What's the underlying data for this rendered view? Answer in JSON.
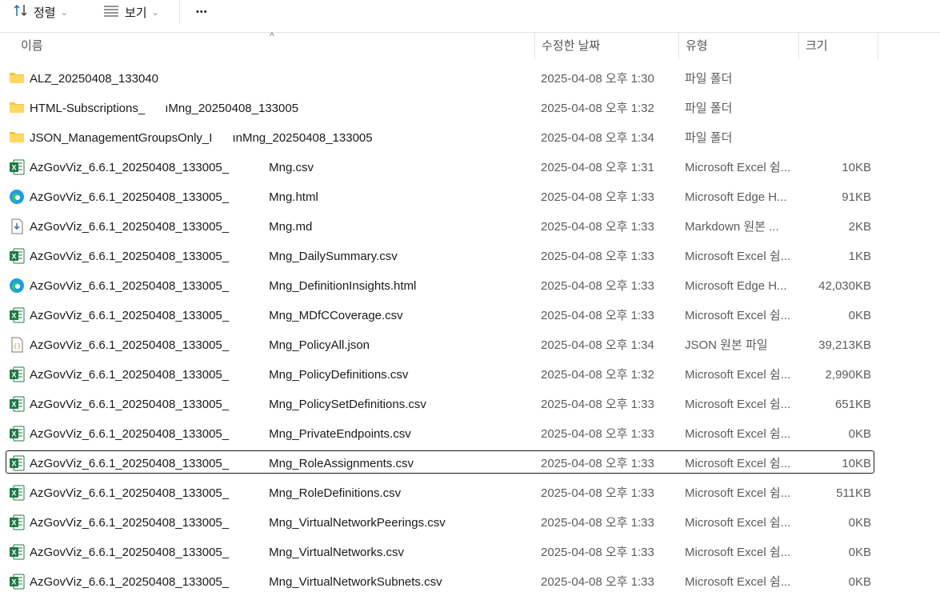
{
  "toolbar": {
    "sort_label": "정렬",
    "view_label": "보기",
    "more_label": "•••"
  },
  "columns": {
    "name": "이름",
    "date": "수정한 날짜",
    "type": "유형",
    "size": "크기"
  },
  "files": [
    {
      "icon": "folder-icon",
      "name": "ALZ_20250408_133040",
      "date": "2025-04-08 오후 1:30",
      "type": "파일 폴더",
      "size": ""
    },
    {
      "icon": "folder-icon",
      "name": "HTML-Subscriptions_      ıMng_20250408_133005",
      "date": "2025-04-08 오후 1:32",
      "type": "파일 폴더",
      "size": ""
    },
    {
      "icon": "folder-icon",
      "name": "JSON_ManagementGroupsOnly_I      ınMng_20250408_133005",
      "date": "2025-04-08 오후 1:34",
      "type": "파일 폴더",
      "size": ""
    },
    {
      "icon": "excel-icon",
      "name": "AzGovViz_6.6.1_20250408_133005_            Mng.csv",
      "date": "2025-04-08 오후 1:31",
      "type": "Microsoft Excel 쉼...",
      "size": "10KB"
    },
    {
      "icon": "edge-icon",
      "name": "AzGovViz_6.6.1_20250408_133005_            Mng.html",
      "date": "2025-04-08 오후 1:33",
      "type": "Microsoft Edge H...",
      "size": "91KB"
    },
    {
      "icon": "markdown-icon",
      "name": "AzGovViz_6.6.1_20250408_133005_            Mng.md",
      "date": "2025-04-08 오후 1:33",
      "type": "Markdown 원본 ...",
      "size": "2KB"
    },
    {
      "icon": "excel-icon",
      "name": "AzGovViz_6.6.1_20250408_133005_            Mng_DailySummary.csv",
      "date": "2025-04-08 오후 1:33",
      "type": "Microsoft Excel 쉼...",
      "size": "1KB"
    },
    {
      "icon": "edge-icon",
      "name": "AzGovViz_6.6.1_20250408_133005_            Mng_DefinitionInsights.html",
      "date": "2025-04-08 오후 1:33",
      "type": "Microsoft Edge H...",
      "size": "42,030KB"
    },
    {
      "icon": "excel-icon",
      "name": "AzGovViz_6.6.1_20250408_133005_            Mng_MDfCCoverage.csv",
      "date": "2025-04-08 오후 1:33",
      "type": "Microsoft Excel 쉼...",
      "size": "0KB"
    },
    {
      "icon": "json-icon",
      "name": "AzGovViz_6.6.1_20250408_133005_            Mng_PolicyAll.json",
      "date": "2025-04-08 오후 1:34",
      "type": "JSON 원본 파일",
      "size": "39,213KB"
    },
    {
      "icon": "excel-icon",
      "name": "AzGovViz_6.6.1_20250408_133005_            Mng_PolicyDefinitions.csv",
      "date": "2025-04-08 오후 1:32",
      "type": "Microsoft Excel 쉼...",
      "size": "2,990KB"
    },
    {
      "icon": "excel-icon",
      "name": "AzGovViz_6.6.1_20250408_133005_            Mng_PolicySetDefinitions.csv",
      "date": "2025-04-08 오후 1:33",
      "type": "Microsoft Excel 쉼...",
      "size": "651KB"
    },
    {
      "icon": "excel-icon",
      "name": "AzGovViz_6.6.1_20250408_133005_            Mng_PrivateEndpoints.csv",
      "date": "2025-04-08 오후 1:33",
      "type": "Microsoft Excel 쉼...",
      "size": "0KB"
    },
    {
      "icon": "excel-icon",
      "name": "AzGovViz_6.6.1_20250408_133005_            Mng_RoleAssignments.csv",
      "date": "2025-04-08 오후 1:33",
      "type": "Microsoft Excel 쉼...",
      "size": "10KB",
      "selected": true
    },
    {
      "icon": "excel-icon",
      "name": "AzGovViz_6.6.1_20250408_133005_            Mng_RoleDefinitions.csv",
      "date": "2025-04-08 오후 1:33",
      "type": "Microsoft Excel 쉼...",
      "size": "511KB"
    },
    {
      "icon": "excel-icon",
      "name": "AzGovViz_6.6.1_20250408_133005_            Mng_VirtualNetworkPeerings.csv",
      "date": "2025-04-08 오후 1:33",
      "type": "Microsoft Excel 쉼...",
      "size": "0KB"
    },
    {
      "icon": "excel-icon",
      "name": "AzGovViz_6.6.1_20250408_133005_            Mng_VirtualNetworks.csv",
      "date": "2025-04-08 오후 1:33",
      "type": "Microsoft Excel 쉼...",
      "size": "0KB"
    },
    {
      "icon": "excel-icon",
      "name": "AzGovViz_6.6.1_20250408_133005_            Mng_VirtualNetworkSubnets.csv",
      "date": "2025-04-08 오후 1:33",
      "type": "Microsoft Excel 쉼...",
      "size": "0KB"
    }
  ],
  "colors": {
    "folder": "#F5C33B",
    "excel": "#1D7A45",
    "edge": "#1B9DE2",
    "selection_border": "#1A1A1A"
  }
}
